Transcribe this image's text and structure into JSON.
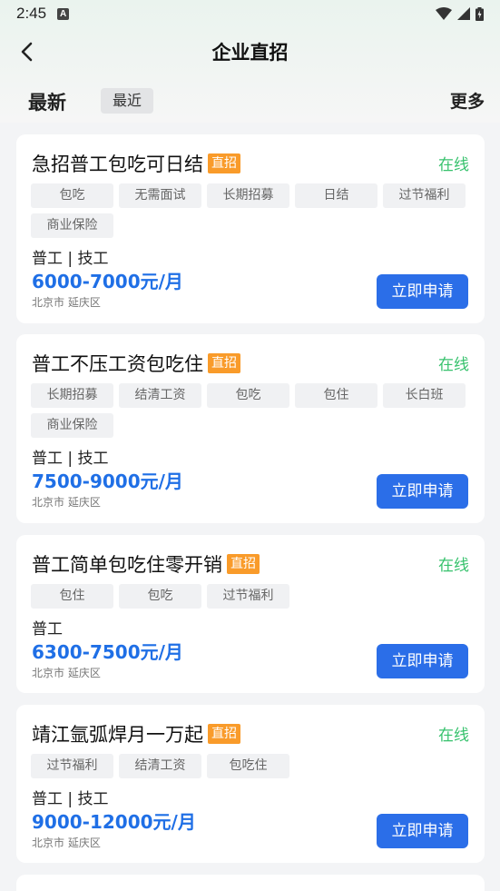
{
  "status": {
    "time": "2:45",
    "a_icon": "A"
  },
  "header": {
    "title": "企业直招"
  },
  "filters": {
    "newest": "最新",
    "recent": "最近",
    "more": "更多"
  },
  "jobs": [
    {
      "title": "急招普工包吃可日结",
      "badge": "直招",
      "status": "在线",
      "tags": [
        "包吃",
        "无需面试",
        "长期招募",
        "日结",
        "过节福利",
        "商业保险"
      ],
      "type": "普工 | 技工",
      "salary": "6000-7000元/月",
      "location": "北京市 延庆区",
      "apply": "立即申请"
    },
    {
      "title": "普工不压工资包吃住",
      "badge": "直招",
      "status": "在线",
      "tags": [
        "长期招募",
        "结清工资",
        "包吃",
        "包住",
        "长白班",
        "商业保险"
      ],
      "type": "普工 | 技工",
      "salary": "7500-9000元/月",
      "location": "北京市 延庆区",
      "apply": "立即申请"
    },
    {
      "title": "普工简单包吃住零开销",
      "badge": "直招",
      "status": "在线",
      "tags": [
        "包住",
        "包吃",
        "过节福利"
      ],
      "type": "普工",
      "salary": "6300-7500元/月",
      "location": "北京市 延庆区",
      "apply": "立即申请"
    },
    {
      "title": "靖江氩弧焊月一万起",
      "badge": "直招",
      "status": "在线",
      "tags": [
        "过节福利",
        "结清工资",
        "包吃住"
      ],
      "type": "普工 | 技工",
      "salary": "9000-12000元/月",
      "location": "北京市 延庆区",
      "apply": "立即申请"
    }
  ]
}
